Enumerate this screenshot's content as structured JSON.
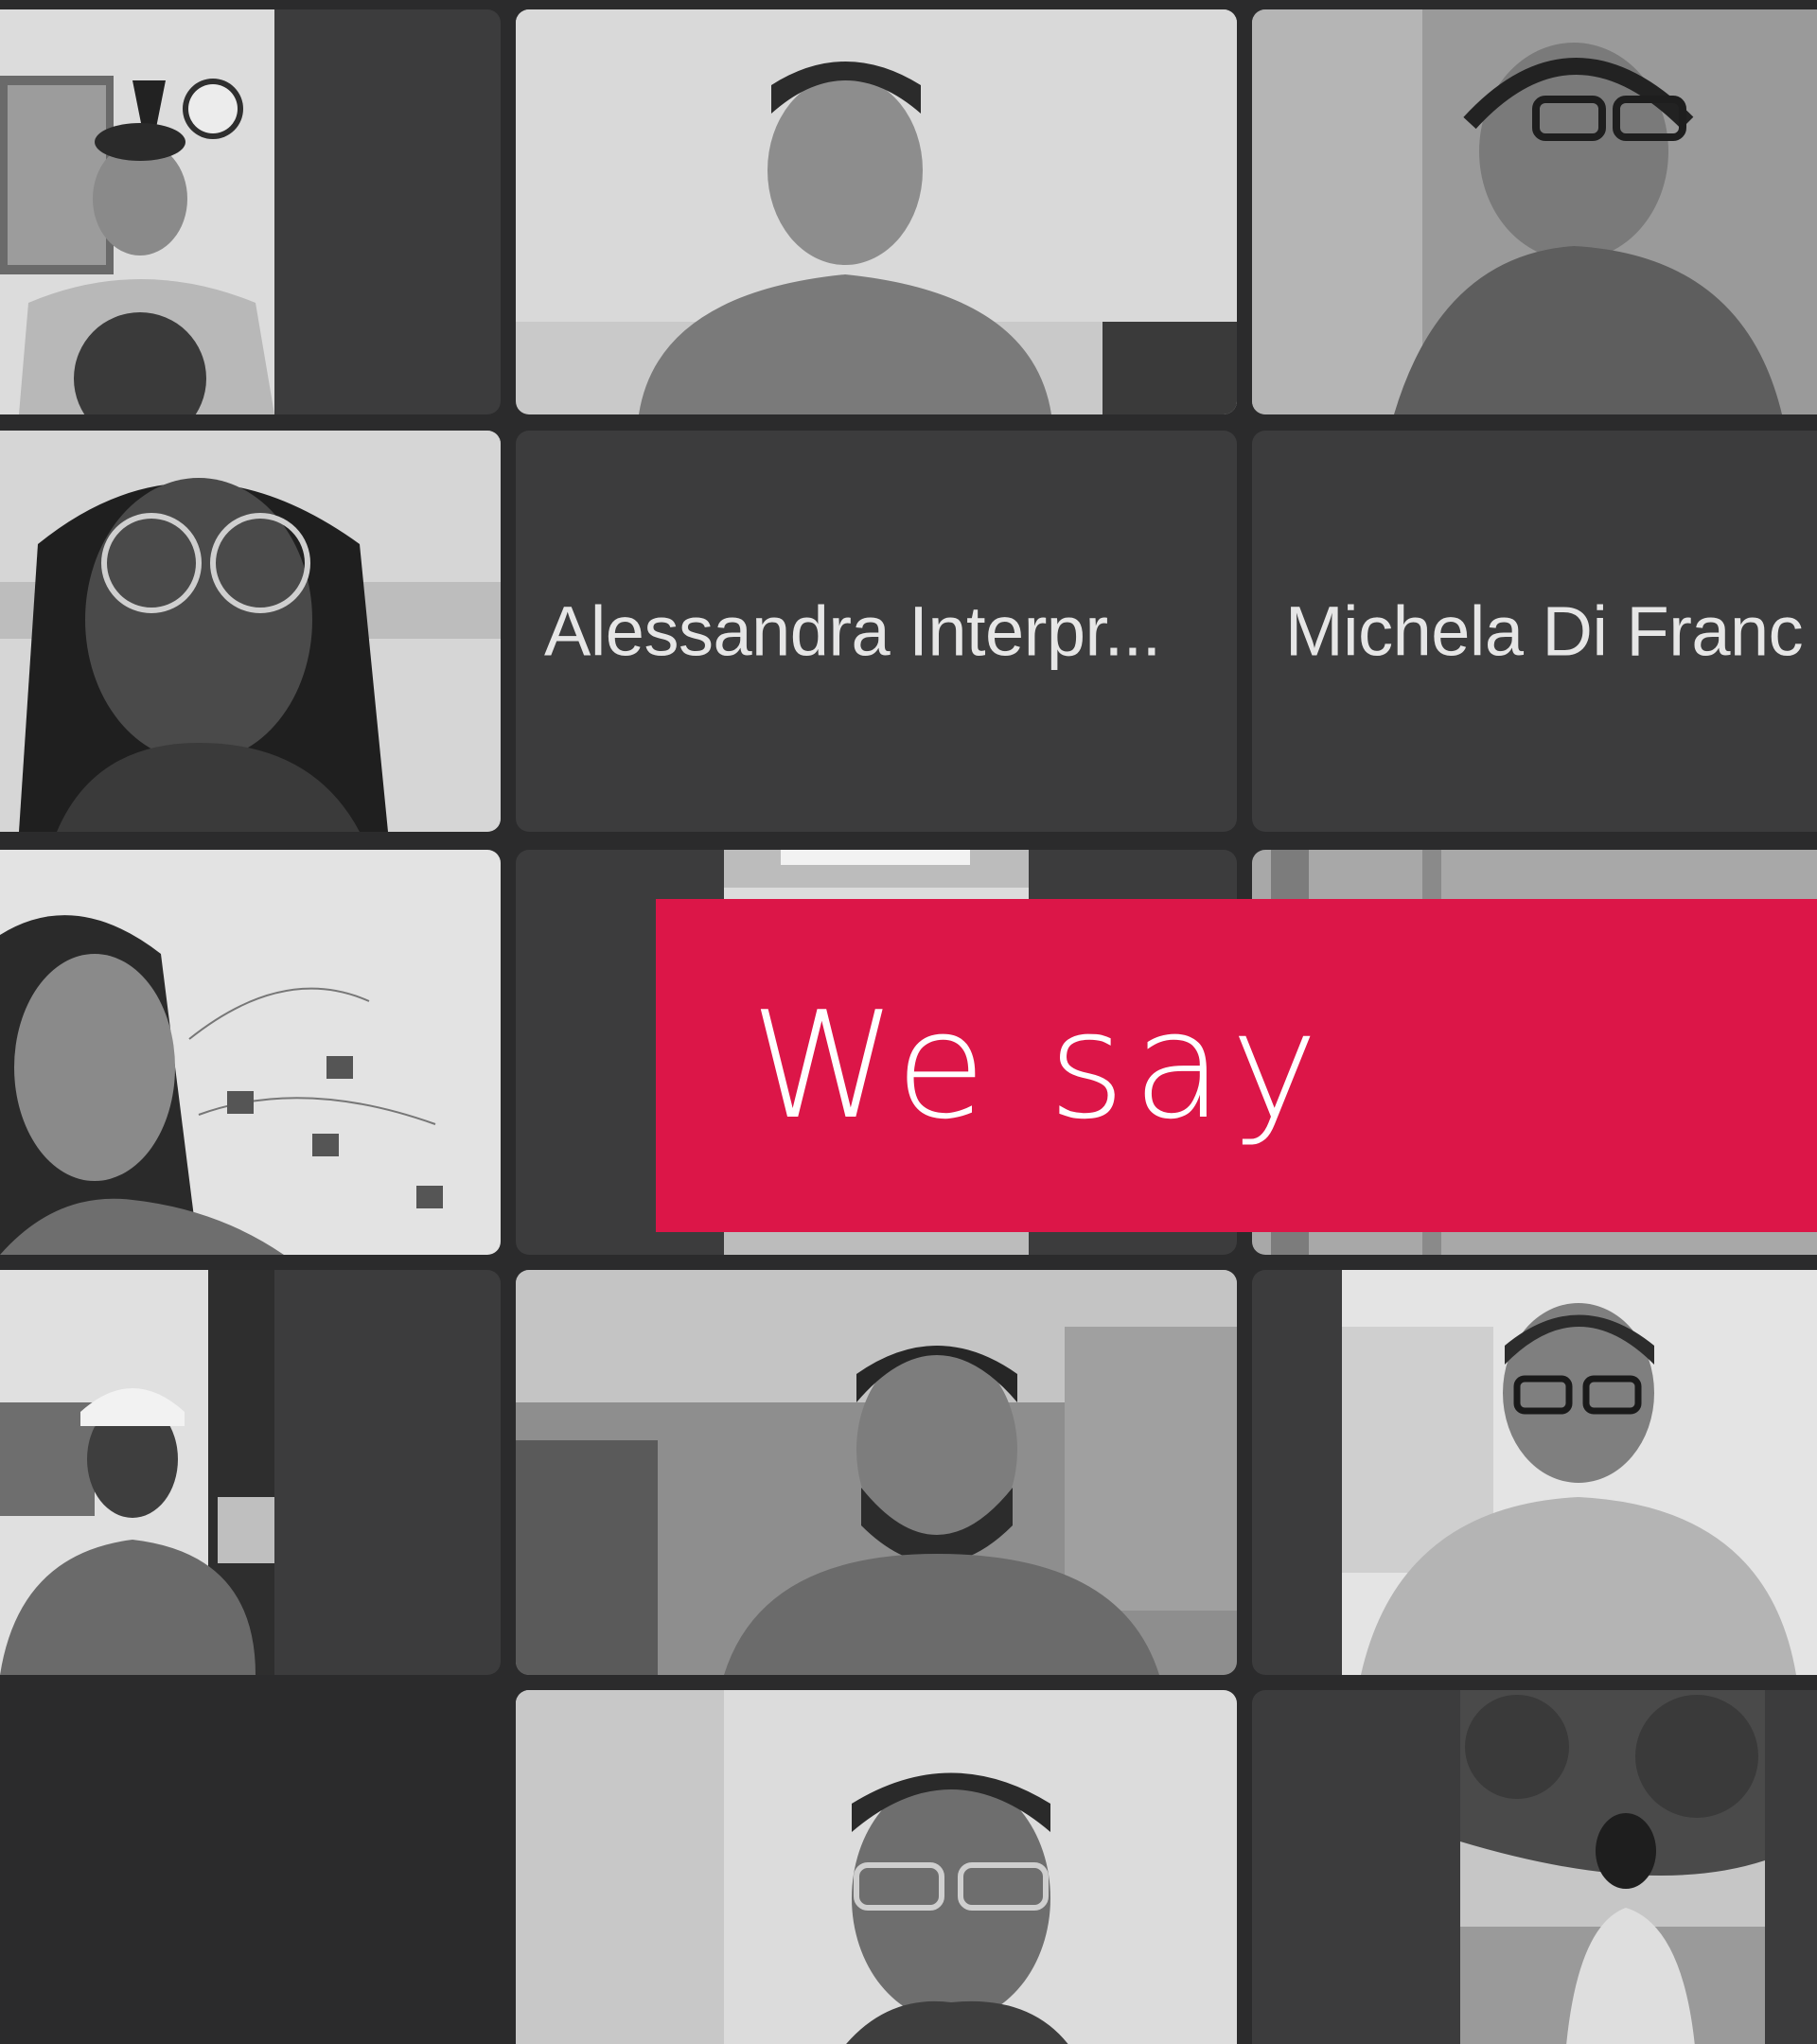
{
  "participants": [
    {
      "id": "p1",
      "type": "video",
      "subject": "man with glasses and graphic t-shirt"
    },
    {
      "id": "p2",
      "type": "video",
      "subject": "smiling man in polo shirt with earphones"
    },
    {
      "id": "p3",
      "type": "video",
      "subject": "person with headset and glasses"
    },
    {
      "id": "p4",
      "type": "video",
      "subject": "woman with braids and round glasses",
      "active_speaker": true
    },
    {
      "id": "p5",
      "type": "name_only",
      "name": "Alessandra Interpr..."
    },
    {
      "id": "p6",
      "type": "name_only",
      "name": "Michela Di Franc"
    },
    {
      "id": "p7",
      "type": "video",
      "subject": "woman in front of photo string lights"
    },
    {
      "id": "p8",
      "type": "video",
      "subject": "partially hidden participant"
    },
    {
      "id": "p9",
      "type": "video",
      "subject": "partially hidden participant"
    },
    {
      "id": "p10",
      "type": "video",
      "subject": "man in white cap in kitchen"
    },
    {
      "id": "p11",
      "type": "video",
      "subject": "bearded man with glasses in plaid shirt"
    },
    {
      "id": "p12",
      "type": "video",
      "subject": "smiling man with glasses in t-shirt"
    },
    {
      "id": "p13",
      "type": "video",
      "subject": "man with glasses, hand on chin"
    },
    {
      "id": "p14",
      "type": "video",
      "subject": "man standing under a tree outdoors"
    }
  ],
  "caption": {
    "text": "We say",
    "background_color": "#dc1648",
    "text_color": "#ffffff"
  },
  "colors": {
    "background": "#2b2b2c",
    "tile": "#3c3c3d",
    "name_text": "#e6e6e6",
    "active_border": "#9a9a9a"
  }
}
